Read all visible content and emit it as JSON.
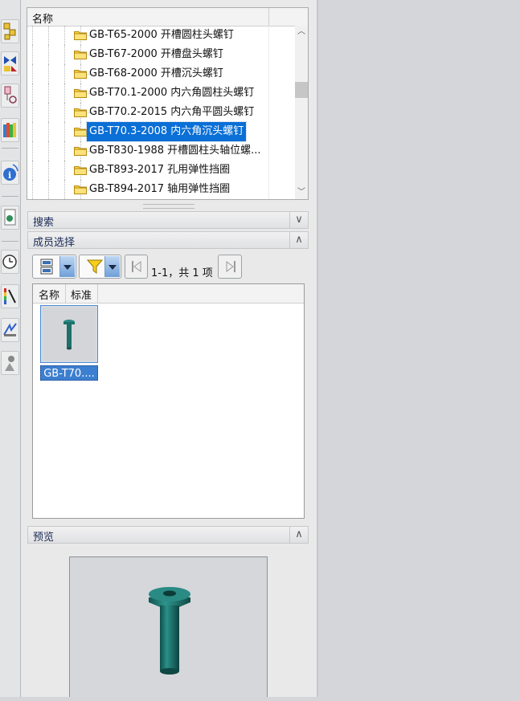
{
  "tree": {
    "header": "名称",
    "items": [
      {
        "label": "GB-T65-2000 开槽圆柱头螺钉",
        "selected": false
      },
      {
        "label": "GB-T67-2000 开槽盘头螺钉",
        "selected": false
      },
      {
        "label": "GB-T68-2000 开槽沉头螺钉",
        "selected": false
      },
      {
        "label": "GB-T70.1-2000 内六角圆柱头螺钉",
        "selected": false
      },
      {
        "label": "GB-T70.2-2015 内六角平圆头螺钉",
        "selected": false
      },
      {
        "label": "GB-T70.3-2008 内六角沉头螺钉",
        "selected": true
      },
      {
        "label": "GB-T830-1988 开槽圆柱头轴位螺...",
        "selected": false
      },
      {
        "label": "GB-T893-2017 孔用弹性挡圈",
        "selected": false
      },
      {
        "label": "GB-T894-2017 轴用弹性挡圈",
        "selected": false
      }
    ]
  },
  "sections": {
    "search": "搜索",
    "member_select": "成员选择",
    "preview": "预览"
  },
  "member": {
    "page_info": "1-1，共 1 项",
    "columns": [
      "名称",
      "标准"
    ],
    "items": [
      {
        "label": "GB-T70...."
      }
    ]
  },
  "colors": {
    "selection": "#0a6fd6",
    "part": "#1f6f6a"
  },
  "toolbar_icons": [
    "assembly-navigator-icon",
    "constraint-navigator-icon",
    "part-navigator-icon",
    "reuse-library-icon",
    "hd3d-tools-icon",
    "web-browser-icon",
    "history-icon",
    "color-palette-icon",
    "process-studio-icon",
    "roles-icon"
  ]
}
